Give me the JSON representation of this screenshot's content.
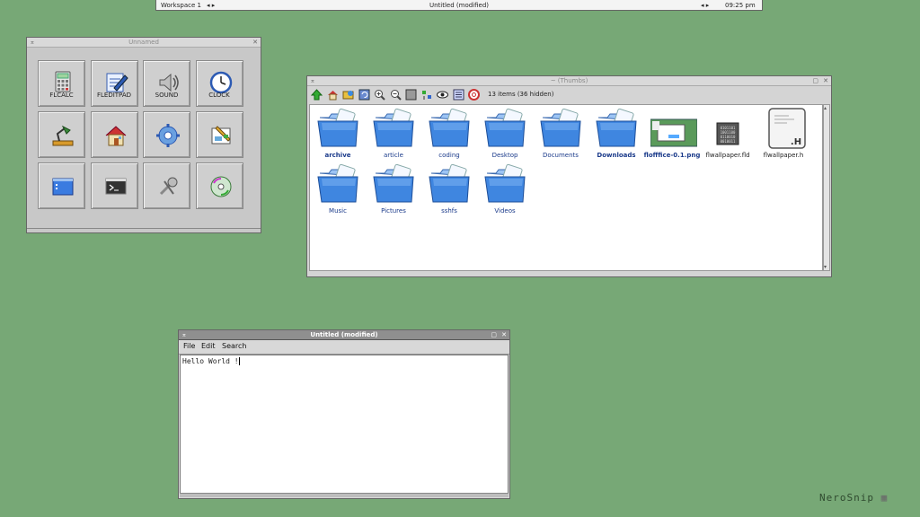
{
  "taskbar": {
    "workspace": "Workspace 1",
    "left_arrows": "◂ ▸",
    "title": "Untitled (modified)",
    "right_arrows": "◂ ▸",
    "clock": "09:25 pm"
  },
  "launcher": {
    "title": "Unnamed",
    "buttons": [
      {
        "label": "FLCALC",
        "icon": "calculator-icon"
      },
      {
        "label": "FLEDITPAD",
        "icon": "editpad-icon"
      },
      {
        "label": "SOUND",
        "icon": "speaker-icon"
      },
      {
        "label": "CLOCK",
        "icon": "clock-icon"
      },
      {
        "label": "",
        "icon": "desk-lamp-icon"
      },
      {
        "label": "",
        "icon": "home-icon"
      },
      {
        "label": "",
        "icon": "network-gear-icon"
      },
      {
        "label": "",
        "icon": "paint-icon"
      },
      {
        "label": "",
        "icon": "desktop-window-icon"
      },
      {
        "label": "",
        "icon": "terminal-icon"
      },
      {
        "label": "",
        "icon": "tools-icon"
      },
      {
        "label": "",
        "icon": "disc-icon"
      }
    ]
  },
  "filemanager": {
    "title": "~ (Thumbs)",
    "status": "13 items (36 hidden)",
    "toolbar_icons": [
      "up-arrow-icon",
      "home-icon",
      "favorites-icon",
      "refresh-icon",
      "zoom-in-icon",
      "zoom-out-icon",
      "view-icon",
      "sort-icon",
      "eye-icon",
      "list-icon",
      "help-icon"
    ],
    "items": [
      {
        "name": "archive",
        "kind": "folder",
        "bold": true
      },
      {
        "name": "article",
        "kind": "folder",
        "bold": false
      },
      {
        "name": "coding",
        "kind": "folder",
        "bold": false
      },
      {
        "name": "Desktop",
        "kind": "folder",
        "bold": false
      },
      {
        "name": "Documents",
        "kind": "folder",
        "bold": false
      },
      {
        "name": "Downloads",
        "kind": "folder",
        "bold": true
      },
      {
        "name": "flofffice-0.1.png",
        "kind": "image",
        "bold": true
      },
      {
        "name": "flwallpaper.fld",
        "kind": "binary",
        "bold": false
      },
      {
        "name": "flwallpaper.h",
        "kind": "header",
        "bold": false
      },
      {
        "name": "Music",
        "kind": "folder",
        "bold": false
      },
      {
        "name": "Pictures",
        "kind": "folder",
        "bold": false
      },
      {
        "name": "sshfs",
        "kind": "folder",
        "bold": false
      },
      {
        "name": "Videos",
        "kind": "folder",
        "bold": false
      }
    ]
  },
  "editor": {
    "title": "Untitled (modified)",
    "menu": {
      "file": "File",
      "edit": "Edit",
      "search": "Search"
    },
    "content": "Hello World !"
  },
  "watermark": "NeroSnip"
}
